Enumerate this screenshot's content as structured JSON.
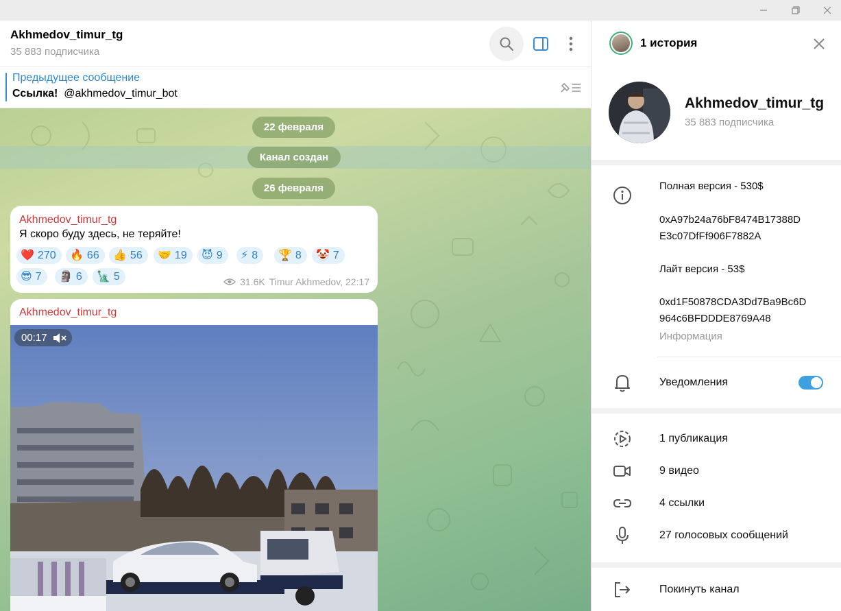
{
  "channel": {
    "title": "Akhmedov_timur_tg",
    "subscribers": "35 883 подписчика"
  },
  "pinned": {
    "title": "Предыдущее сообщение",
    "bold": "Ссылка!",
    "text": "@akhmedov_timur_bot"
  },
  "dates": [
    "22 февраля",
    "Канал создан",
    "26 февраля"
  ],
  "message1": {
    "author": "Akhmedov_timur_tg",
    "text": "Я скоро буду здесь, не теряйте!",
    "reactions": [
      {
        "emoji": "❤️",
        "count": "270"
      },
      {
        "emoji": "🔥",
        "count": "66"
      },
      {
        "emoji": "👍",
        "count": "56"
      },
      {
        "emoji": "🤝",
        "count": "19"
      },
      {
        "emoji": "😈",
        "count": "9"
      },
      {
        "emoji": "⚡",
        "count": "8"
      },
      {
        "emoji": "🏆",
        "count": "8"
      },
      {
        "emoji": "🤡",
        "count": "7"
      },
      {
        "emoji": "😎",
        "count": "7"
      },
      {
        "emoji": "🗿",
        "count": "6"
      },
      {
        "emoji": "🗽",
        "count": "5"
      }
    ],
    "views": "31.6K",
    "signature": "Timur Akhmedov, 22:17"
  },
  "message2": {
    "author": "Akhmedov_timur_tg",
    "video_time": "00:17"
  },
  "panel": {
    "story": "1 история",
    "name": "Akhmedov_timur_tg",
    "subscribers": "35 883 подписчика",
    "info_lines": [
      "Полная версия - 530$",
      "0xA97b24a76bF8474B17388D",
      "E3c07DfFf906F7882A",
      "Лайт версия - 53$",
      "0xd1F50878CDA3Dd7Ba9Bc6D",
      "964c6BFDDDE8769A48"
    ],
    "info_caption": "Информация",
    "notifications": "Уведомления",
    "notifications_on": true,
    "media_rows": [
      "1 публикация",
      "9 видео",
      "4 ссылки",
      "27 голосовых сообщений"
    ],
    "leave": "Покинуть канал"
  },
  "colors": {
    "accent": "#3fa0df",
    "author": "#cc3b3b",
    "link": "#2f87d1"
  }
}
